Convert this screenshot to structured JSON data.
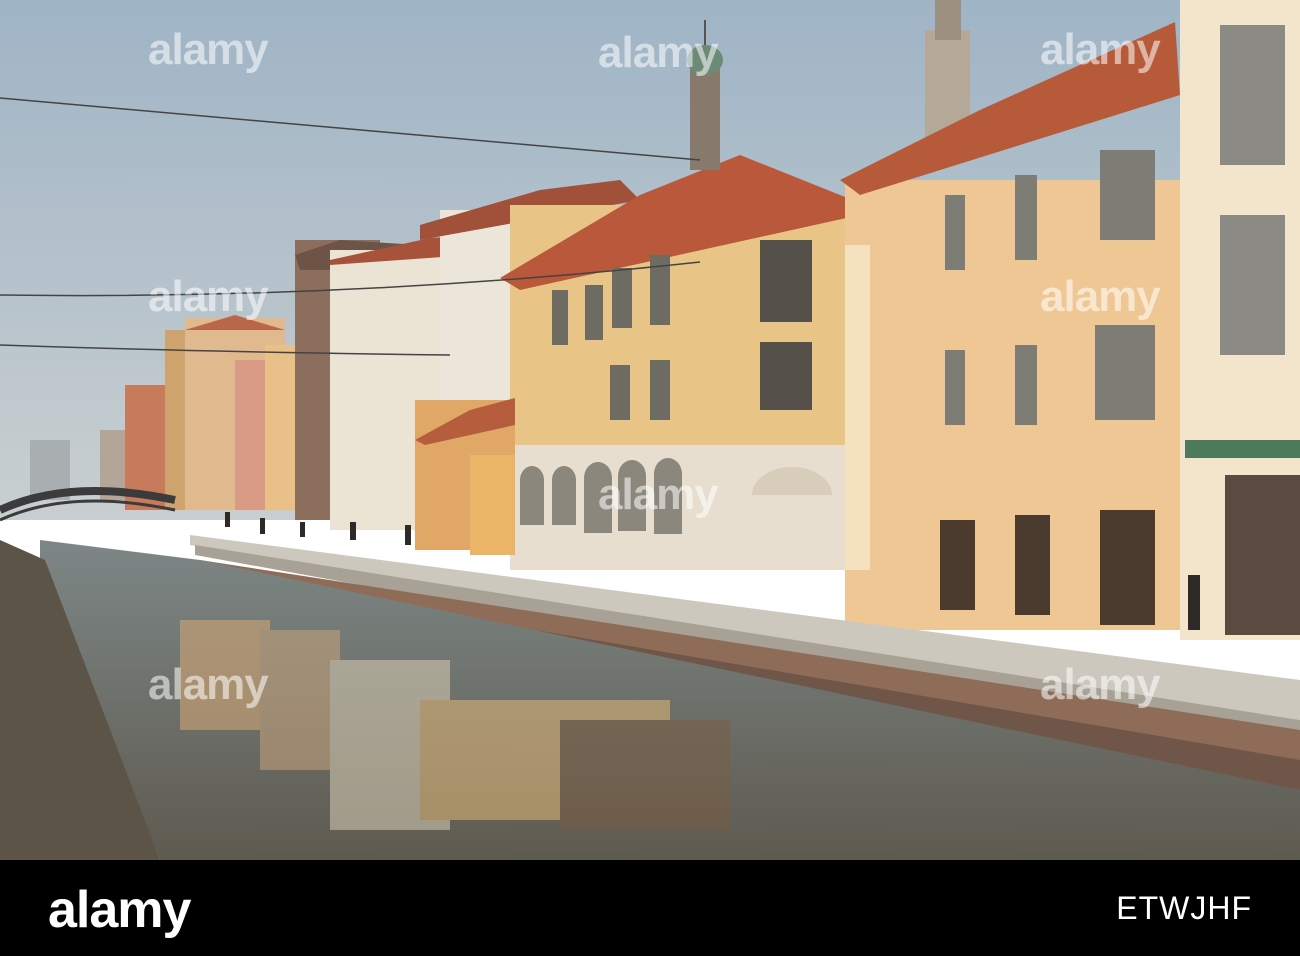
{
  "watermark": {
    "text": "alamy"
  },
  "footer": {
    "logo": "alamy",
    "image_id": "ETWJHF"
  },
  "colors": {
    "sky": "#adc0cf",
    "water": "#8a8f8a",
    "terracotta": "#b4583a",
    "ochre": "#e9c48a",
    "footer_bg": "#000000"
  }
}
